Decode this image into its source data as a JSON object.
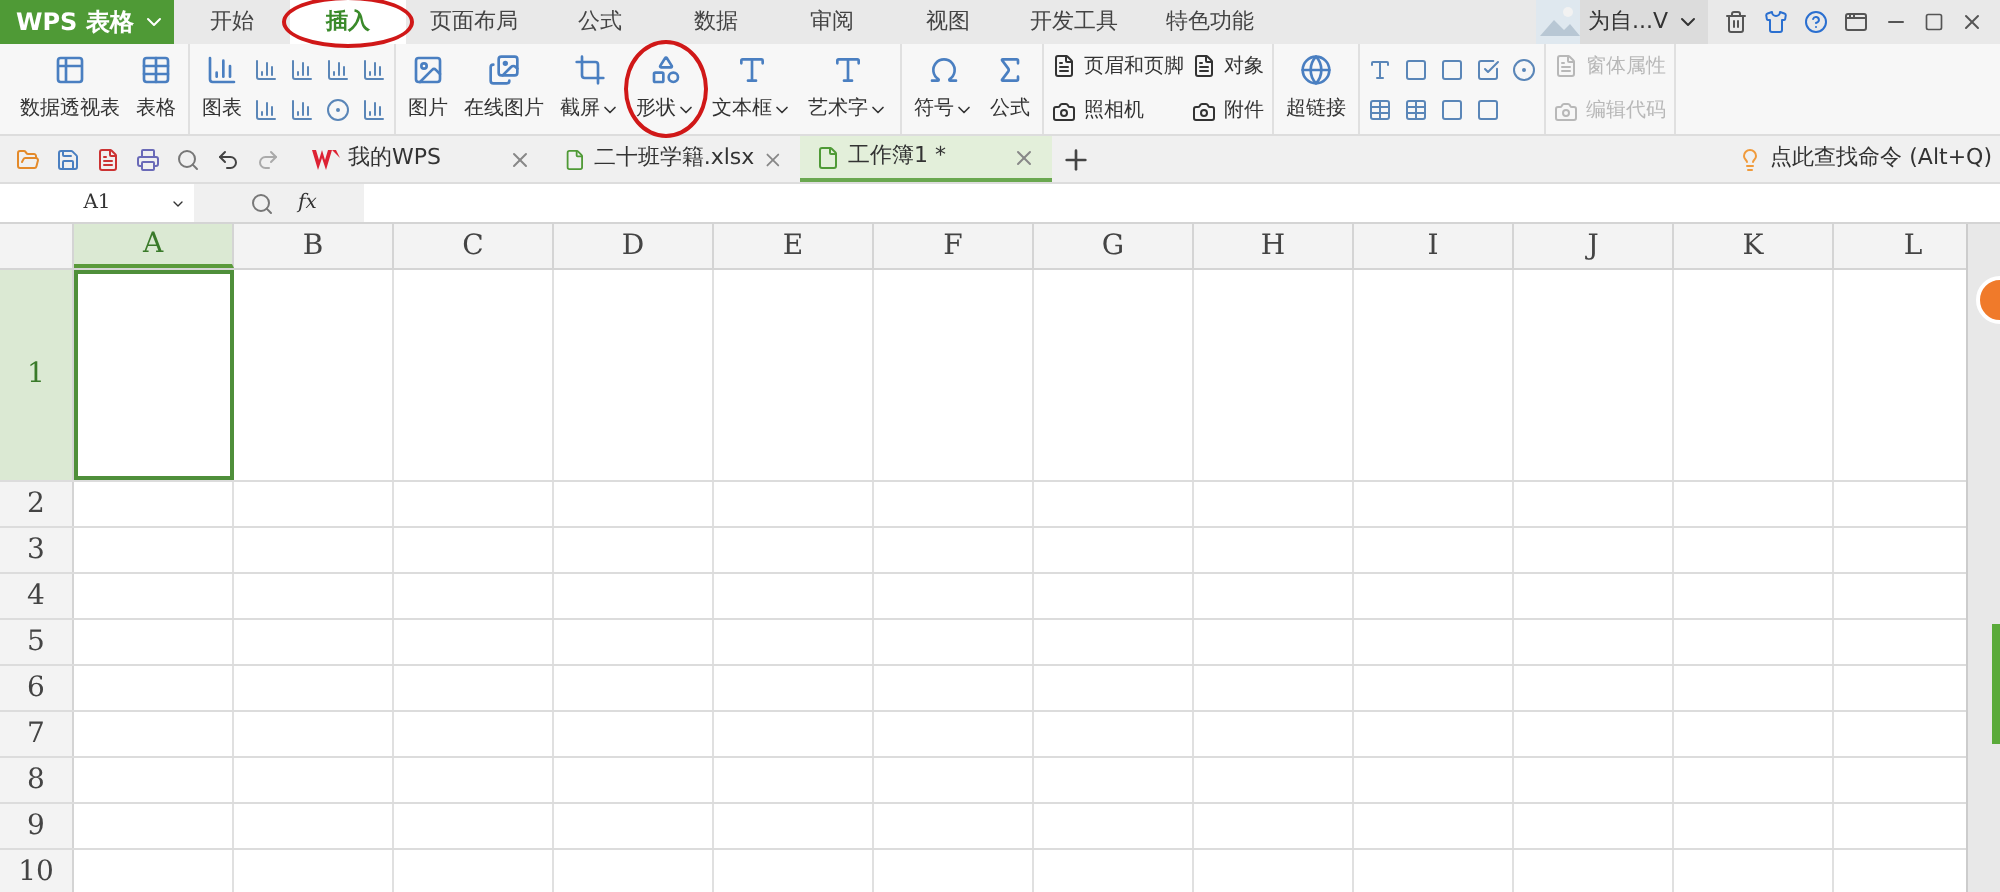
{
  "app_button": "WPS 表格",
  "menu_tabs": [
    {
      "label": "开始",
      "selected": false
    },
    {
      "label": "插入",
      "selected": true,
      "circled": true
    },
    {
      "label": "页面布局",
      "selected": false
    },
    {
      "label": "公式",
      "selected": false
    },
    {
      "label": "数据",
      "selected": false
    },
    {
      "label": "审阅",
      "selected": false
    },
    {
      "label": "视图",
      "selected": false
    },
    {
      "label": "开发工具",
      "selected": false
    },
    {
      "label": "特色功能",
      "selected": false
    }
  ],
  "user_name": "为自...V",
  "ribbon_groups": [
    {
      "items": [
        {
          "kind": "large",
          "label": "数据透视表"
        },
        {
          "kind": "large",
          "label": "表格"
        }
      ]
    },
    {
      "items": [
        {
          "kind": "large",
          "label": "图表"
        },
        {
          "kind": "chart_icons"
        }
      ]
    },
    {
      "items": [
        {
          "kind": "large",
          "label": "图片"
        },
        {
          "kind": "large",
          "label": "在线图片"
        },
        {
          "kind": "large",
          "label": "截屏",
          "dropdown": true
        },
        {
          "kind": "large",
          "label": "形状",
          "dropdown": true,
          "circled": true
        },
        {
          "kind": "large",
          "label": "文本框",
          "dropdown": true
        },
        {
          "kind": "large",
          "label": "艺术字",
          "dropdown": true
        }
      ]
    },
    {
      "items": [
        {
          "kind": "large",
          "label": "符号",
          "dropdown": true
        },
        {
          "kind": "large",
          "label": "公式"
        }
      ]
    },
    {
      "items": [
        {
          "kind": "stack",
          "entries": [
            {
              "label": "页眉和页脚",
              "disabled": false
            },
            {
              "label": "照相机",
              "disabled": false
            }
          ]
        },
        {
          "kind": "stack",
          "entries": [
            {
              "label": "对象",
              "disabled": false
            },
            {
              "label": "附件",
              "disabled": false
            }
          ]
        }
      ]
    },
    {
      "items": [
        {
          "kind": "large",
          "label": "超链接"
        }
      ]
    },
    {
      "items": [
        {
          "kind": "form_icons"
        }
      ]
    },
    {
      "items": [
        {
          "kind": "stack",
          "entries": [
            {
              "label": "窗体属性",
              "disabled": true
            },
            {
              "label": "编辑代码",
              "disabled": true
            }
          ]
        }
      ]
    }
  ],
  "doc_tabs": [
    {
      "label": "我的WPS",
      "kind": "home",
      "selected": false
    },
    {
      "label": "二十班学籍.xlsx",
      "kind": "file",
      "selected": false
    },
    {
      "label": "工作簿1 *",
      "kind": "file",
      "selected": true
    }
  ],
  "command_search": "点此查找命令 (Alt+Q)",
  "name_box": "A1",
  "fx_label": "fx",
  "columns": [
    {
      "label": "A",
      "selected": true
    },
    {
      "label": "B",
      "selected": false
    },
    {
      "label": "C",
      "selected": false
    },
    {
      "label": "D",
      "selected": false
    },
    {
      "label": "E",
      "selected": false
    },
    {
      "label": "F",
      "selected": false
    },
    {
      "label": "G",
      "selected": false
    },
    {
      "label": "H",
      "selected": false
    },
    {
      "label": "I",
      "selected": false
    },
    {
      "label": "J",
      "selected": false
    },
    {
      "label": "K",
      "selected": false
    },
    {
      "label": "L",
      "selected": false
    }
  ],
  "rows": [
    {
      "label": "1",
      "selected": true
    },
    {
      "label": "2",
      "selected": false
    },
    {
      "label": "3",
      "selected": false
    },
    {
      "label": "4",
      "selected": false
    },
    {
      "label": "5",
      "selected": false
    },
    {
      "label": "6",
      "selected": false
    },
    {
      "label": "7",
      "selected": false
    },
    {
      "label": "8",
      "selected": false
    },
    {
      "label": "9",
      "selected": false
    },
    {
      "label": "10",
      "selected": false
    }
  ]
}
